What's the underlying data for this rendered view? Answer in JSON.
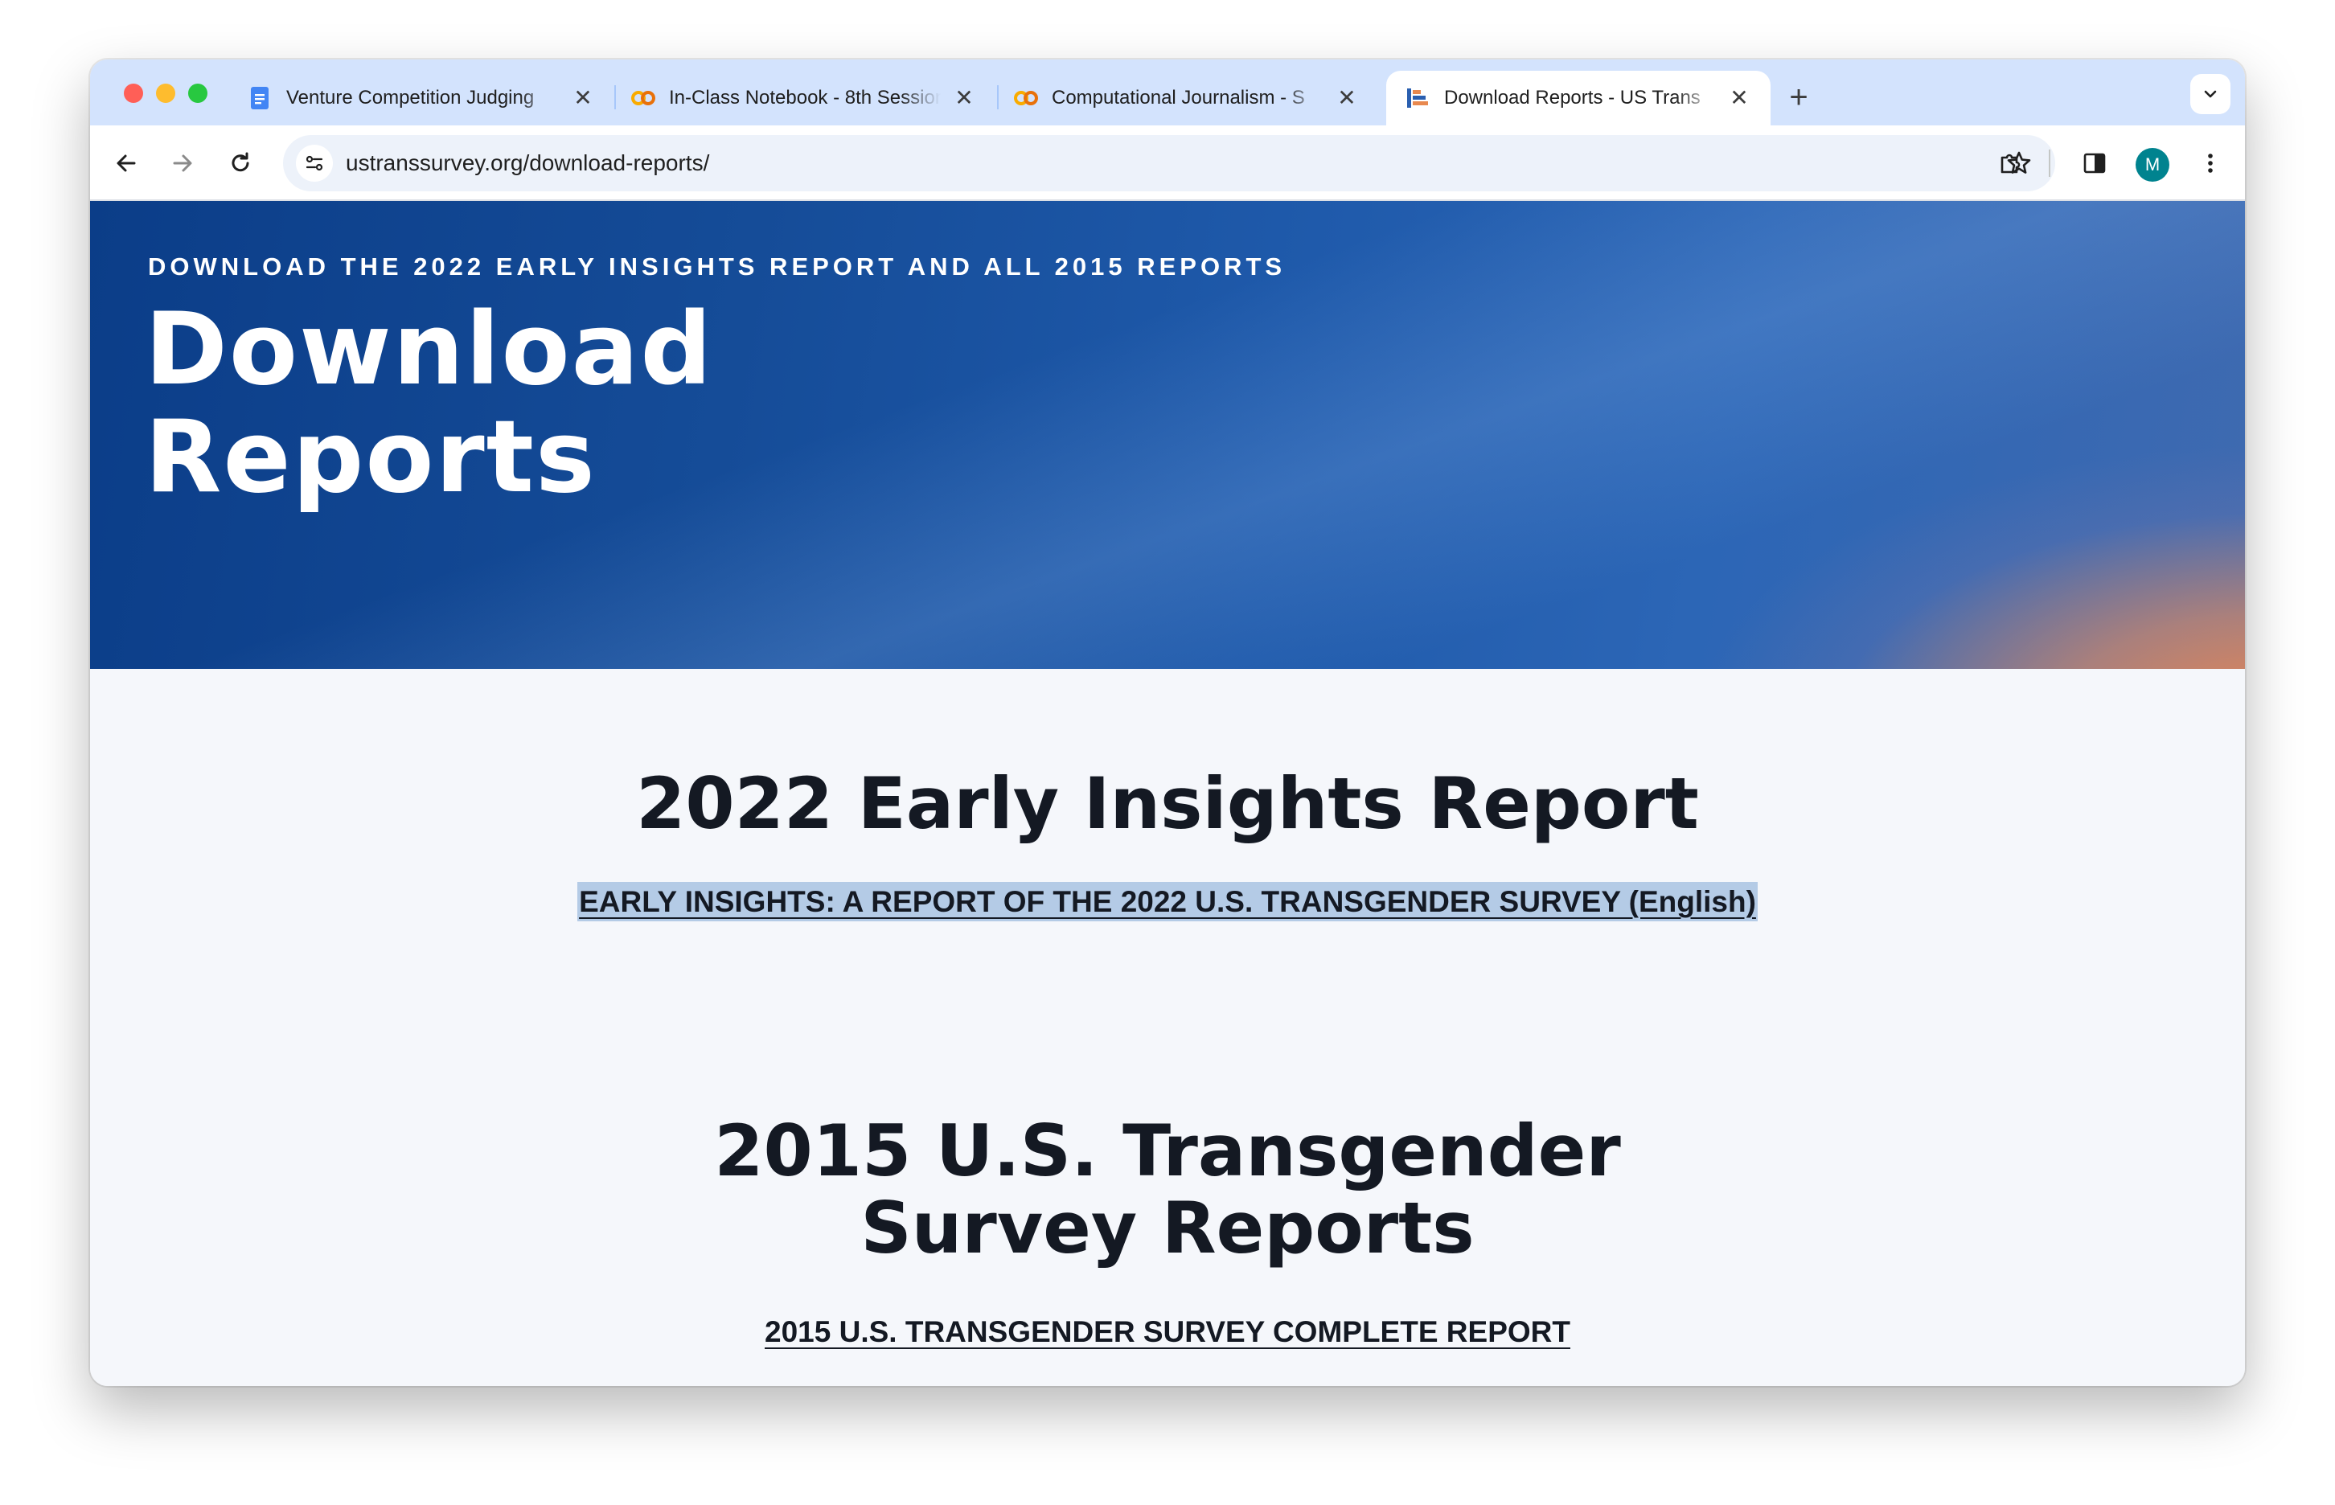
{
  "browser": {
    "tabs": [
      {
        "title": "Venture Competition Judging",
        "icon": "google-docs-icon",
        "active": false
      },
      {
        "title": "In-Class Notebook - 8th Session",
        "icon": "colab-icon",
        "active": false
      },
      {
        "title": "Computational Journalism - S",
        "icon": "colab-icon",
        "active": false
      },
      {
        "title": "Download Reports - US Trans",
        "icon": "ustranssurvey-icon",
        "active": true
      }
    ],
    "new_tab_label": "+",
    "url": "ustranssurvey.org/download-reports/",
    "profile_initial": "M",
    "colors": {
      "tabstrip": "#d3e3fd",
      "avatar": "#00838f"
    }
  },
  "hero": {
    "kicker": "DOWNLOAD THE 2022 EARLY INSIGHTS REPORT AND ALL 2015 REPORTS",
    "title_line1": "Download",
    "title_line2": "Reports"
  },
  "sections": [
    {
      "title": "2022 Early Insights Report",
      "links": [
        "EARLY INSIGHTS: A REPORT OF THE 2022 U.S. TRANSGENDER SURVEY (English)"
      ]
    },
    {
      "title_line1": "2015 U.S. Transgender",
      "title_line2": "Survey Reports",
      "links": [
        "2015 U.S. TRANSGENDER SURVEY COMPLETE REPORT"
      ]
    }
  ]
}
